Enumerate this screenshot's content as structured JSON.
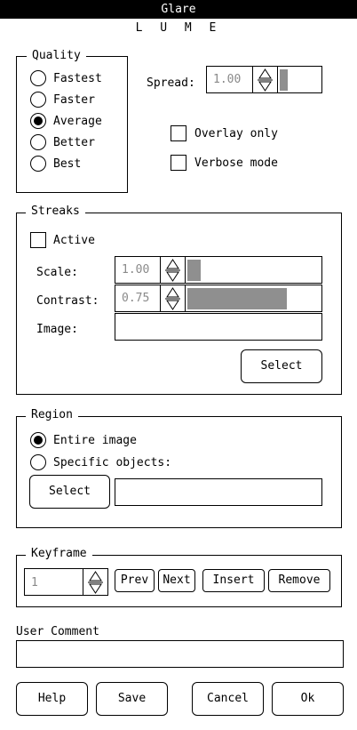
{
  "window": {
    "title": "Glare",
    "subtitle": "L U M E"
  },
  "quality": {
    "legend": "Quality",
    "options": [
      {
        "label": "Fastest",
        "selected": false
      },
      {
        "label": "Faster",
        "selected": false
      },
      {
        "label": "Average",
        "selected": true
      },
      {
        "label": "Better",
        "selected": false
      },
      {
        "label": "Best",
        "selected": false
      }
    ]
  },
  "spread": {
    "label": "Spread:",
    "value": "1.00",
    "level": 0.2
  },
  "overlay_only": {
    "label": "Overlay only",
    "checked": false
  },
  "verbose_mode": {
    "label": "Verbose mode",
    "checked": false
  },
  "streaks": {
    "legend": "Streaks",
    "active": {
      "label": "Active",
      "checked": false
    },
    "scale": {
      "label": "Scale:",
      "value": "1.00",
      "level": 0.1
    },
    "contrast": {
      "label": "Contrast:",
      "value": "0.75",
      "level": 0.75
    },
    "image": {
      "label": "Image:",
      "value": ""
    },
    "select_label": "Select"
  },
  "region": {
    "legend": "Region",
    "options": [
      {
        "label": "Entire image",
        "selected": true
      },
      {
        "label": "Specific objects:",
        "selected": false
      }
    ],
    "select_label": "Select",
    "objects_value": ""
  },
  "keyframe": {
    "legend": "Keyframe",
    "value": "1",
    "prev_label": "Prev",
    "next_label": "Next",
    "insert_label": "Insert",
    "remove_label": "Remove"
  },
  "user_comment": {
    "label": "User Comment",
    "value": ""
  },
  "footer": {
    "help_label": "Help",
    "save_label": "Save",
    "cancel_label": "Cancel",
    "ok_label": "Ok"
  },
  "icons": {
    "spinner": "up-down-arrows-icon"
  }
}
